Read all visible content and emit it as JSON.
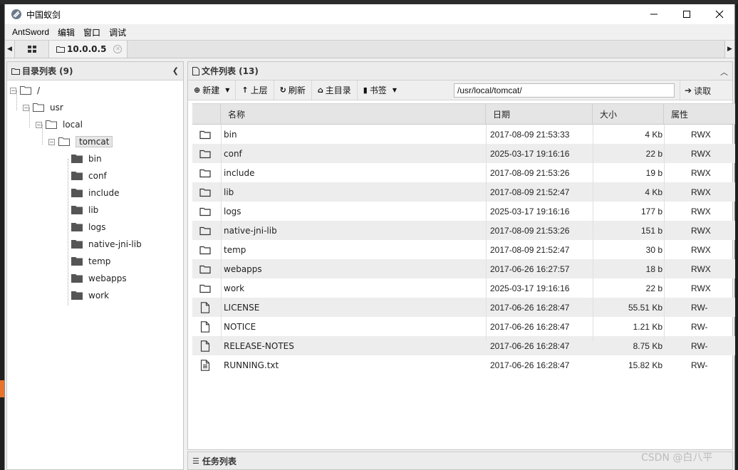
{
  "window": {
    "title": "中国蚁剑"
  },
  "menu": [
    "AntSword",
    "编辑",
    "窗口",
    "调试"
  ],
  "tabs": {
    "active_label": "10.0.0.5"
  },
  "left_panel": {
    "title": "目录列表 (9)",
    "tree": [
      {
        "label": "/",
        "level": 0,
        "toggle": "−"
      },
      {
        "label": "usr",
        "level": 1,
        "toggle": "−"
      },
      {
        "label": "local",
        "level": 2,
        "toggle": "−"
      },
      {
        "label": "tomcat",
        "level": 3,
        "toggle": "−",
        "selected": true
      },
      {
        "label": "bin",
        "level": 4
      },
      {
        "label": "conf",
        "level": 4
      },
      {
        "label": "include",
        "level": 4
      },
      {
        "label": "lib",
        "level": 4
      },
      {
        "label": "logs",
        "level": 4
      },
      {
        "label": "native-jni-lib",
        "level": 4
      },
      {
        "label": "temp",
        "level": 4
      },
      {
        "label": "webapps",
        "level": 4
      },
      {
        "label": "work",
        "level": 4
      }
    ]
  },
  "right_panel": {
    "title": "文件列表 (13)",
    "toolbar": {
      "new_label": "新建",
      "up_label": "上层",
      "refresh_label": "刷新",
      "home_label": "主目录",
      "bookmark_label": "书签",
      "path": "/usr/local/tomcat/",
      "read_label": "读取"
    },
    "columns": [
      "名称",
      "日期",
      "大小",
      "属性"
    ],
    "files": [
      {
        "type": "folder",
        "name": "bin",
        "date": "2017-08-09 21:53:33",
        "size": "4 Kb",
        "attr": "RWX"
      },
      {
        "type": "folder",
        "name": "conf",
        "date": "2025-03-17 19:16:16",
        "size": "22 b",
        "attr": "RWX"
      },
      {
        "type": "folder",
        "name": "include",
        "date": "2017-08-09 21:53:26",
        "size": "19 b",
        "attr": "RWX"
      },
      {
        "type": "folder",
        "name": "lib",
        "date": "2017-08-09 21:52:47",
        "size": "4 Kb",
        "attr": "RWX"
      },
      {
        "type": "folder",
        "name": "logs",
        "date": "2025-03-17 19:16:16",
        "size": "177 b",
        "attr": "RWX"
      },
      {
        "type": "folder",
        "name": "native-jni-lib",
        "date": "2017-08-09 21:53:26",
        "size": "151 b",
        "attr": "RWX"
      },
      {
        "type": "folder",
        "name": "temp",
        "date": "2017-08-09 21:52:47",
        "size": "30 b",
        "attr": "RWX"
      },
      {
        "type": "folder",
        "name": "webapps",
        "date": "2017-06-26 16:27:57",
        "size": "18 b",
        "attr": "RWX"
      },
      {
        "type": "folder",
        "name": "work",
        "date": "2025-03-17 19:16:16",
        "size": "22 b",
        "attr": "RWX"
      },
      {
        "type": "file",
        "name": "LICENSE",
        "date": "2017-06-26 16:28:47",
        "size": "55.51 Kb",
        "attr": "RW-"
      },
      {
        "type": "file",
        "name": "NOTICE",
        "date": "2017-06-26 16:28:47",
        "size": "1.21 Kb",
        "attr": "RW-"
      },
      {
        "type": "file",
        "name": "RELEASE-NOTES",
        "date": "2017-06-26 16:28:47",
        "size": "8.75 Kb",
        "attr": "RW-"
      },
      {
        "type": "text",
        "name": "RUNNING.txt",
        "date": "2017-06-26 16:28:47",
        "size": "15.82 Kb",
        "attr": "RW-"
      }
    ]
  },
  "task_panel": {
    "title": "任务列表"
  },
  "watermark": "CSDN @白八平"
}
